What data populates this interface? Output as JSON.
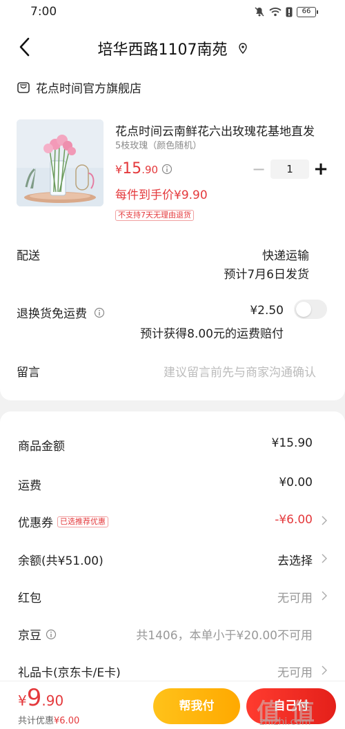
{
  "status_bar": {
    "time": "7:00",
    "battery": "66"
  },
  "nav": {
    "title": "培华西路1107南苑"
  },
  "shop": {
    "name": "花点时间官方旗舰店"
  },
  "product": {
    "title": "花点时间云南鲜花六出玫瑰花基地直发",
    "spec": "5枝玫瑰（颜色随机）",
    "price_currency": "¥",
    "price_int": "15",
    "price_dec": ".90",
    "each_price": "每件到手价¥9.90",
    "return_tag": "不支持7天无理由退货",
    "quantity": "1",
    "minus": "−",
    "plus": "+"
  },
  "delivery": {
    "label": "配送",
    "method": "快递运输",
    "estimate": "预计7月6日发货"
  },
  "return_shipping": {
    "label": "退换货免运费",
    "price": "¥2.50",
    "note": "预计获得8.00元的运费赔付",
    "enabled": false
  },
  "message": {
    "label": "留言",
    "placeholder": "建议留言前先与商家沟通确认"
  },
  "summary": {
    "goods_amount": {
      "label": "商品金额",
      "value": "¥15.90"
    },
    "shipping": {
      "label": "运费",
      "value": "¥0.00"
    },
    "coupon": {
      "label": "优惠券",
      "badge": "已选推荐优惠",
      "value": "-¥6.00"
    },
    "balance": {
      "label": "余额(共¥51.00)",
      "value": "去选择"
    },
    "red_packet": {
      "label": "红包",
      "value": "无可用"
    },
    "jingdou": {
      "label": "京豆",
      "value": "共1406，本单小于¥20.00不可用"
    },
    "gift_card": {
      "label": "礼品卡(京东卡/E卡)",
      "value": "无可用"
    }
  },
  "bottom_bar": {
    "currency": "¥",
    "total_int": "9",
    "total_dec": ".90",
    "saved_label": "共计优惠",
    "saved_value": "¥6.00",
    "help_pay": "帮我付",
    "self_pay": "自己付"
  },
  "watermark": {
    "text": "值 值 值",
    "url": "zhizhi.com"
  },
  "colors": {
    "accent_red": "#e4393c",
    "help_button": "#ffb400",
    "pay_button": "#f0281f"
  }
}
